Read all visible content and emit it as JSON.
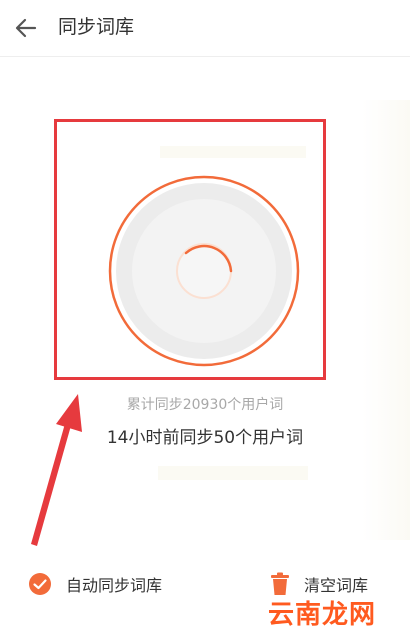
{
  "header": {
    "title": "同步词库",
    "back_icon": "arrow-left-icon"
  },
  "stats": {
    "total_synced": "累计同步20930个用户词",
    "recent_synced": "14小时前同步50个用户词"
  },
  "footer": {
    "auto_sync_label": "自动同步词库",
    "auto_sync_checked": true,
    "clear_label": "清空词库"
  },
  "watermark": {
    "text": "云南龙网"
  },
  "colors": {
    "accent": "#f26b3a",
    "highlight": "#e63a3e",
    "watermark": "#ff5a1f"
  }
}
